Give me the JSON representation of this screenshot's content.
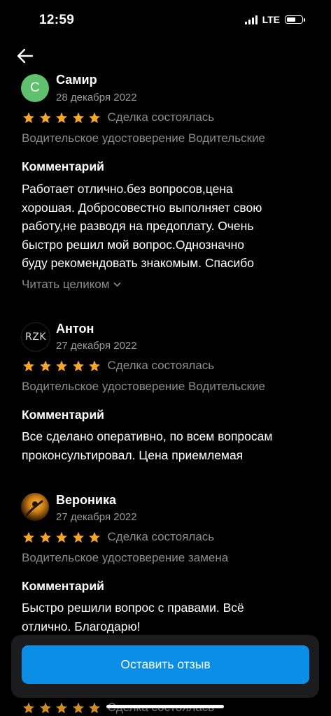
{
  "status_bar": {
    "time": "12:59",
    "network": "LTE",
    "battery_percent": 65
  },
  "colors": {
    "star": "#f5a623",
    "button": "#0a8ee6",
    "avatar_c": "#5fc16d"
  },
  "reviews": [
    {
      "name": "Самир",
      "date": "28 декабря 2022",
      "avatar_letter": "С",
      "rating": 5,
      "deal_status": "Сделка состоялась",
      "service": "Водительское удостоверение Водительские",
      "comment_header": "Комментарий",
      "comment_lines": [
        "Работает  отлично.без вопросов,цена",
        "хорошая. Добросовестно выполняет свою",
        "работу,не разводя на предоплату. Очень",
        "быстро решил мой вопрос.Однозначно",
        "буду рекомендовать знакомым. Спасибо"
      ],
      "read_more": "Читать целиком"
    },
    {
      "name": "Антон",
      "date": "27 декабря 2022",
      "avatar_text": "RZK",
      "rating": 5,
      "deal_status": "Сделка состоялась",
      "service": "Водительское удостоверение Водительские",
      "comment_header": "Комментарий",
      "comment_lines": [
        "Все сделано оперативно, по всем вопросам",
        "проконсультировал. Цена приемлемая"
      ]
    },
    {
      "name": "Вероника",
      "date": "27 декабря 2022",
      "rating": 5,
      "deal_status": "Сделка состоялась",
      "service": "Водительское удостоверение замена",
      "comment_header": "Комментарий",
      "comment_lines": [
        "Быстро решили вопрос с правами. Всё",
        "отлично. Благодарю!"
      ]
    },
    {
      "rating": 5,
      "deal_status": "Сделка состоялась"
    }
  ],
  "cta": {
    "label": "Оставить отзыв"
  }
}
